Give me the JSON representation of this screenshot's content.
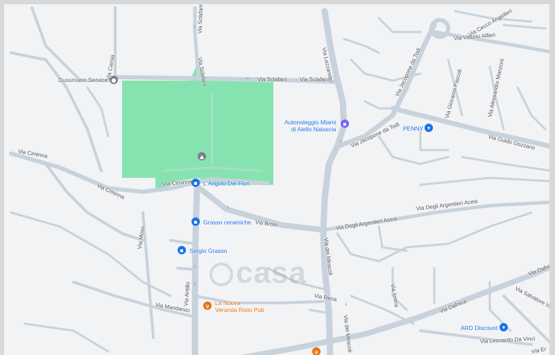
{
  "streets": {
    "via_carnia": "Via Carnia",
    "via_sclafani_v": "Via Sclafani",
    "via_sclafani_1": "Via Sclafani",
    "via_sclafani_2": "Via Sclafani",
    "via_sclafani_3": "Via Sclafani",
    "via_lazzaretto": "Via Lazzaretto",
    "via_jacopone_1": "Via Jacopone da Todi",
    "via_jacopone_2": "Via Jacopone da Todi",
    "via_cecco": "Via Cecco Angiolieri",
    "via_alfieri": "Via Vittorio Alfieri",
    "via_pascoli": "Via Giovanni Pascoli",
    "via_manzoni": "Via Alessandro Manzoni",
    "via_gozzano": "Via Guido Gozzano",
    "via_ciminna_1": "Via Ciminna",
    "via_ciminna_2": "Via Ciminna",
    "via_ciminna_3": "Via Ciminna",
    "via_brolo": "Via Brolo",
    "via_argentieri_1": "Via Degli Argentieri Acesi",
    "via_argentieri_2": "Via Degli Argentieri Acesi",
    "via_miracoli_1": "Via dei Miracoli",
    "via_miracoli_2": "Via dei Miracoli",
    "via_moso": "Via Moso",
    "via_antillo": "Via Antillo",
    "via_mandanici": "Via Mandanici",
    "via_rena": "Via Rena",
    "via_imera": "Via Imera",
    "via_dafnica_1": "Via Dafnica",
    "via_dafnica_2": "Via Dafnic",
    "via_salvatore": "Via Salvatore Vigo",
    "via_leonardo": "Via Leonardo Da Vinci",
    "via_er": "Via Er"
  },
  "pois": {
    "dussmann": "Dussmann Service",
    "autonoleggio_1": "Autonoleggio Miami",
    "autonoleggio_2": "di Aiello Natascia",
    "penny": "PENNY",
    "angolo": "L'Angolo Dei Fiori",
    "grasso_ceramiche": "Grasso ceramiche",
    "sergio": "Sergio Grasso",
    "veranda_1": "La Nuova",
    "veranda_2": "Veranda Risto Pub",
    "ard": "ARD Discount"
  },
  "watermark": "casa",
  "icons": {
    "place": "place-pin-icon",
    "shop": "shopping-bag-icon",
    "cart": "shopping-cart-icon",
    "car": "car-rental-icon",
    "restaurant": "restaurant-icon"
  },
  "colors": {
    "park": "#86e3b0",
    "road": "#c7d2dc",
    "blue_poi": "#1a73e8",
    "orange_poi": "#e8710a"
  }
}
